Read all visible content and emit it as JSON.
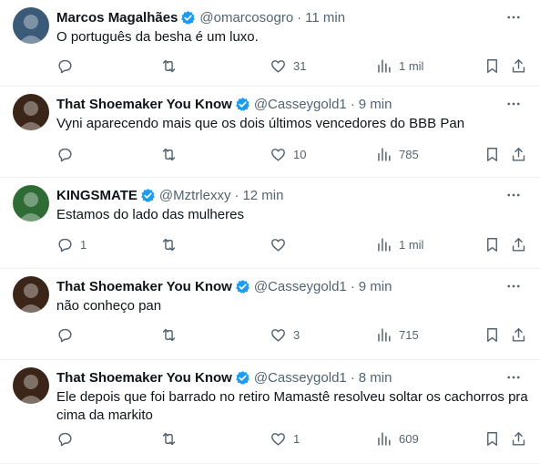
{
  "tweets": [
    {
      "name": "Marcos Magalhães",
      "handle": "@omarcosogro",
      "separator": "·",
      "time": "11 min",
      "text": "O português da besha é um luxo.",
      "replies": "",
      "retweets": "",
      "likes": "31",
      "views": "1 mil",
      "avatar_color": "#3a5a78"
    },
    {
      "name": "That Shoemaker You Know",
      "handle": "@Casseygold1",
      "separator": "·",
      "time": "9 min",
      "text": "Vyni aparecendo mais que os dois últimos vencedores do BBB Pan",
      "replies": "",
      "retweets": "",
      "likes": "10",
      "views": "785",
      "avatar_color": "#3b2418"
    },
    {
      "name": "KINGSMATE",
      "handle": "@Mztrlexxy",
      "separator": "·",
      "time": "12 min",
      "text": "Estamos do lado das mulheres",
      "replies": "1",
      "retweets": "",
      "likes": "",
      "views": "1 mil",
      "avatar_color": "#2f6b35"
    },
    {
      "name": "That Shoemaker You Know",
      "handle": "@Casseygold1",
      "separator": "·",
      "time": "9 min",
      "text": "não conheço pan",
      "replies": "",
      "retweets": "",
      "likes": "3",
      "views": "715",
      "avatar_color": "#3b2418"
    },
    {
      "name": "That Shoemaker You Know",
      "handle": "@Casseygold1",
      "separator": "·",
      "time": "8 min",
      "text": "Ele depois que foi barrado no retiro Mamastê resolveu soltar os cachorros pra cima da markito",
      "replies": "",
      "retweets": "",
      "likes": "1",
      "views": "609",
      "avatar_color": "#3b2418"
    }
  ],
  "icons": {
    "verified": "verified-badge-icon",
    "more": "more-icon",
    "reply": "reply-icon",
    "retweet": "retweet-icon",
    "like": "heart-icon",
    "views": "views-icon",
    "bookmark": "bookmark-icon",
    "share": "share-icon"
  },
  "colors": {
    "verified": "#1d9bf0",
    "text": "#0f1419",
    "secondary": "#536471",
    "divider": "#eff3f4"
  }
}
